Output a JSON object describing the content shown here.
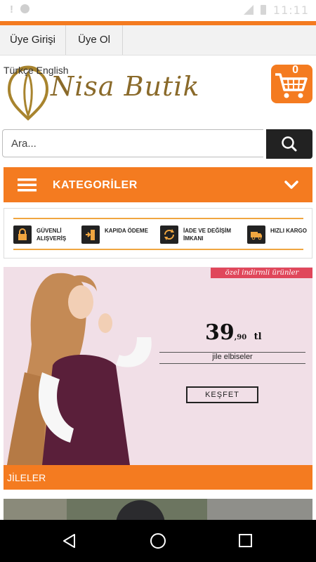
{
  "status_bar": {
    "time": "11:11"
  },
  "top_nav": {
    "login": "Üye Girişi",
    "register": "Üye Ol"
  },
  "header": {
    "languages": "Türkçe English",
    "brand": "Nisa Butik",
    "cart_count": "0"
  },
  "search": {
    "placeholder": "Ara..."
  },
  "category_bar": {
    "title": "KATEGORİLER"
  },
  "features": [
    {
      "label": "GÜVENLİ\nALIŞVERİŞ",
      "icon": "lock-icon"
    },
    {
      "label": "KAPIDA ÖDEME",
      "icon": "door-icon"
    },
    {
      "label": "İADE VE DEĞİŞİM\nİMKANI",
      "icon": "refresh-icon"
    },
    {
      "label": "HIZLI KARGO",
      "icon": "truck-icon"
    }
  ],
  "banner": {
    "promo_tag": "özel indirmli ürünler",
    "price_main": "39",
    "price_cents": ",90",
    "price_unit": "tl",
    "caption": "jile elbiseler",
    "button": "KEŞFET"
  },
  "section": {
    "title": "JİLELER"
  },
  "colors": {
    "accent": "#f47b20",
    "promo": "#e0475b",
    "banner_bg": "#f1dfe7"
  }
}
